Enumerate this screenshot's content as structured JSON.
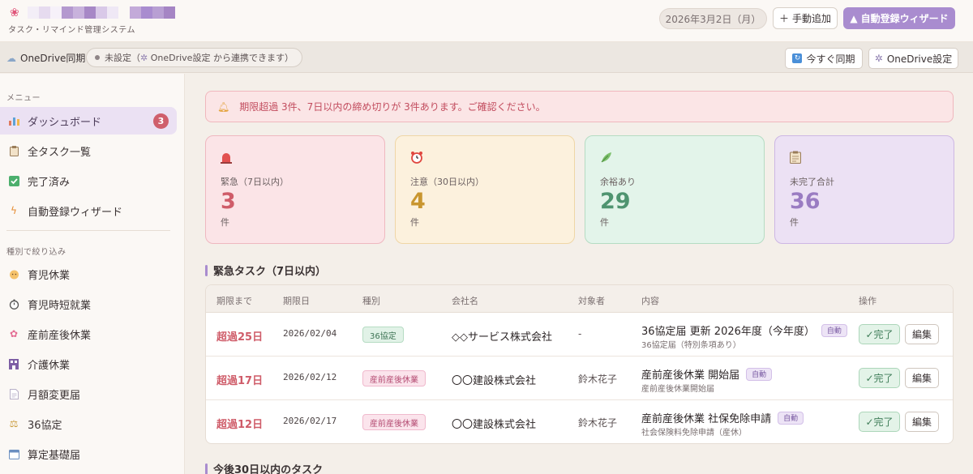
{
  "header": {
    "logo_icon": "cherry-blossom-icon",
    "subtitle": "タスク・リマインド管理システム",
    "date": "2026年3月2日（月）",
    "manual_add": "手動追加",
    "wizard": "自動登録ウィザード"
  },
  "syncbar": {
    "title": "OneDrive同期",
    "status": "未設定（",
    "status_link": "OneDrive設定 から連携できます）",
    "sync_now": "今すぐ同期",
    "settings": "OneDrive設定"
  },
  "sidebar": {
    "menu_heading": "メニュー",
    "menu": [
      {
        "label": "ダッシュボード",
        "icon": "bar-chart-icon",
        "badge": "3"
      },
      {
        "label": "全タスク一覧",
        "icon": "clipboard-icon"
      },
      {
        "label": "完了済み",
        "icon": "checkbox-icon"
      },
      {
        "label": "自動登録ウィザード",
        "icon": "lightning-icon"
      }
    ],
    "filter_heading": "種別で絞り込み",
    "filters": [
      {
        "label": "育児休業",
        "icon": "baby-icon"
      },
      {
        "label": "育児時短就業",
        "icon": "stopwatch-icon"
      },
      {
        "label": "産前産後休業",
        "icon": "blossom-icon"
      },
      {
        "label": "介護休業",
        "icon": "building-icon"
      },
      {
        "label": "月額変更届",
        "icon": "document-icon"
      },
      {
        "label": "36協定",
        "icon": "scales-icon"
      },
      {
        "label": "算定基礎届",
        "icon": "calendar-icon"
      }
    ]
  },
  "alert": {
    "icon": "bell-icon",
    "text": "期限超過 3件、7日以内の締め切りが 3件あります。ご確認ください。"
  },
  "cards": [
    {
      "icon": "siren-icon",
      "label": "緊急（7日以内）",
      "value": "3",
      "unit": "件"
    },
    {
      "icon": "alarm-clock-icon",
      "label": "注意（30日以内）",
      "value": "4",
      "unit": "件"
    },
    {
      "icon": "leaf-icon",
      "label": "余裕あり",
      "value": "29",
      "unit": "件"
    },
    {
      "icon": "clipboard-icon",
      "label": "未完了合計",
      "value": "36",
      "unit": "件"
    }
  ],
  "urgent_section": {
    "title": "緊急タスク（7日以内）",
    "headers": [
      "期限まで",
      "期限日",
      "種別",
      "会社名",
      "対象者",
      "内容",
      "操作"
    ],
    "rows": [
      {
        "overdue": "超過25日",
        "date": "2026/02/04",
        "type": "36協定",
        "company": "◇◇サービス株式会社",
        "person": "-",
        "title": "36協定届 更新 2026年度（今年度）",
        "auto": "自動",
        "sub": "36協定届（特別条項あり）",
        "done": "✓完了",
        "edit": "編集"
      },
      {
        "overdue": "超過17日",
        "date": "2026/02/12",
        "type": "産前産後休業",
        "company": "〇〇建設株式会社",
        "person": "鈴木花子",
        "title": "産前産後休業 開始届",
        "auto": "自動",
        "sub": "産前産後休業開始届",
        "done": "✓完了",
        "edit": "編集"
      },
      {
        "overdue": "超過12日",
        "date": "2026/02/17",
        "type": "産前産後休業",
        "company": "〇〇建設株式会社",
        "person": "鈴木花子",
        "title": "産前産後休業 社保免除申請",
        "auto": "自動",
        "sub": "社会保険料免除申請（産休）",
        "done": "✓完了",
        "edit": "編集"
      }
    ]
  },
  "upcoming_section": {
    "title": "今後30日以内のタスク"
  }
}
